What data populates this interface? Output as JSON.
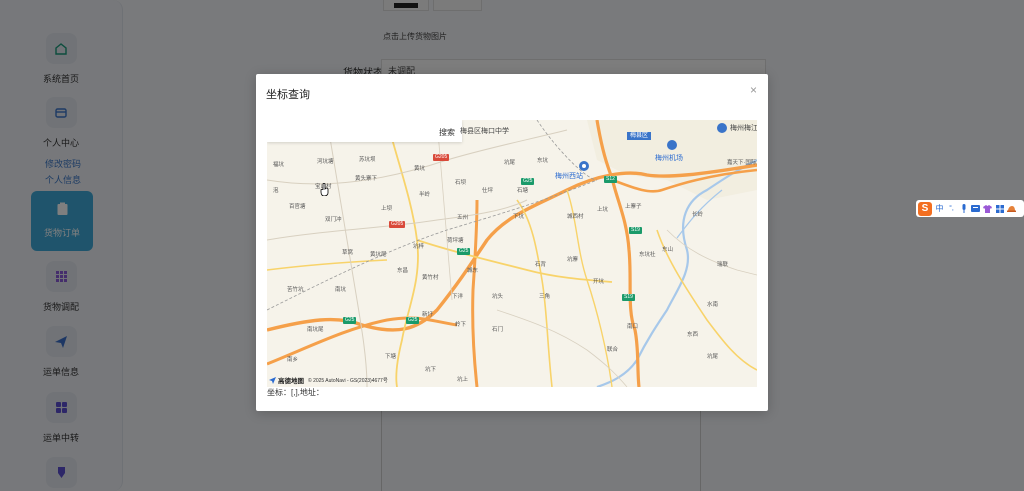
{
  "sidebar": {
    "items": [
      {
        "label": "系统首页",
        "icon": "home-icon"
      },
      {
        "label": "个人中心",
        "icon": "wallet-icon"
      },
      {
        "label": "货物订单",
        "icon": "clipboard-icon"
      },
      {
        "label": "货物调配",
        "icon": "grid-icon"
      },
      {
        "label": "运单信息",
        "icon": "send-icon"
      },
      {
        "label": "运单中转",
        "icon": "apps-icon"
      }
    ],
    "sub_items": [
      "修改密码",
      "个人信息"
    ]
  },
  "page": {
    "upload_hint": "点击上传货物图片",
    "status_label": "货物状态",
    "status_value": "未调配"
  },
  "modal": {
    "title": "坐标查询",
    "close": "×",
    "search_button": "搜索",
    "coords_text": "坐标：[,],地址：",
    "attribution_logo": "高德地图",
    "attribution_text": "© 2025 AutoNavi - GS(2023)4677号"
  },
  "map": {
    "places": [
      "梅县区梅口中学",
      "梅县区",
      "梅州梅江",
      "梅州机场",
      "梅州西站",
      "嘉天下·国际旅游",
      "河坑塘",
      "苏坑坝",
      "黄头寨下",
      "黄坑",
      "石坝",
      "福坑",
      "泡",
      "百官塘",
      "宝山村",
      "双门冲",
      "上坝",
      "半岭",
      "草窝",
      "黄坑尾",
      "坑梓",
      "五州",
      "荷坪塘",
      "东昌",
      "黄竹村",
      "城东",
      "仕坪",
      "坑尾",
      "东坑",
      "石塘",
      "下坑",
      "城西村",
      "石背",
      "坑头",
      "下洋",
      "三角",
      "坑寨",
      "开坑",
      "上坑",
      "岭下",
      "石门",
      "上寨子",
      "东坑社",
      "东山",
      "瑞联",
      "水南",
      "长岭",
      "南口",
      "联合",
      "东西",
      "坑尾",
      "南坑尾",
      "苦竹坑",
      "南坑",
      "新圩",
      "下塘",
      "坑下",
      "坑上",
      "南乡"
    ],
    "roads": [
      "G205",
      "G205",
      "G25",
      "G25",
      "G25",
      "S12",
      "S19",
      "S19",
      "G25"
    ],
    "county": "梅县区"
  },
  "ime": {
    "label": "中",
    "items": [
      "°,",
      "mic",
      "kb",
      "shirt",
      "grid",
      "hat"
    ]
  }
}
